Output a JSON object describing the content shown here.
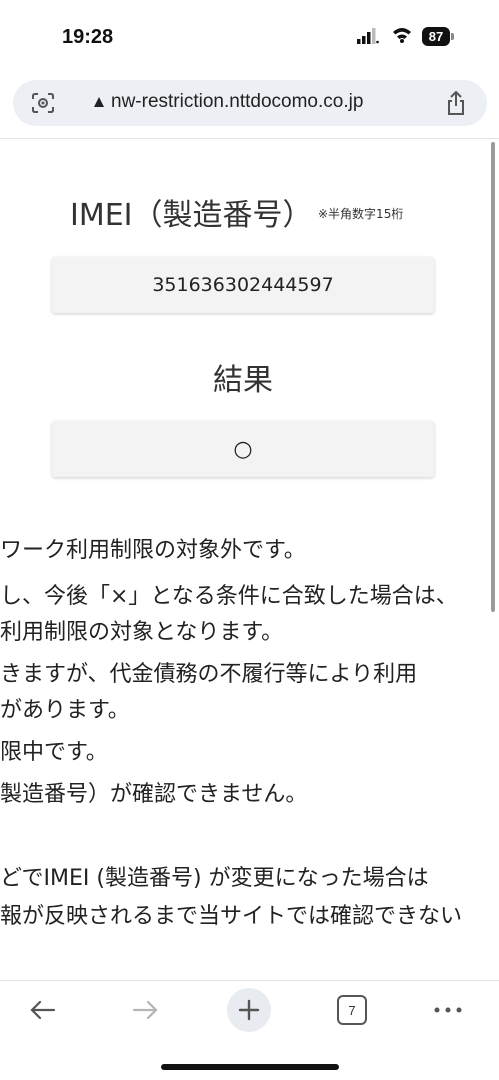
{
  "status": {
    "time": "19:28",
    "battery": "87"
  },
  "browser": {
    "url": "nw-restriction.nttdocomo.co.jp",
    "tab_count": "7"
  },
  "form": {
    "imei_label": "IMEI（製造番号）",
    "imei_note": "※半角数字15桁",
    "imei_value": "351636302444597",
    "result_label": "結果",
    "result_value": "○"
  },
  "notes": [
    "ワーク利用制限の対象外です。",
    "し、今後「×」となる条件に合致した場合は、",
    "利用制限の対象となります。",
    "きますが、代金債務の不履行等により利用",
    "があります。",
    "限中です。",
    "製造番号）が確認できません。",
    "どでIMEI (製造番号) が変更になった場合は",
    "報が反映されるまで当サイトでは確認できない"
  ],
  "colors": {
    "url_bar_bg": "#ecf0f5",
    "field_bg": "#f3f3f3"
  },
  "icons": {
    "lens": "google-lens-icon",
    "lock": "lock-icon",
    "share": "share-icon",
    "back": "back-arrow-icon",
    "forward": "forward-arrow-icon",
    "new_tab": "plus-icon",
    "menu": "more-dots-icon"
  }
}
